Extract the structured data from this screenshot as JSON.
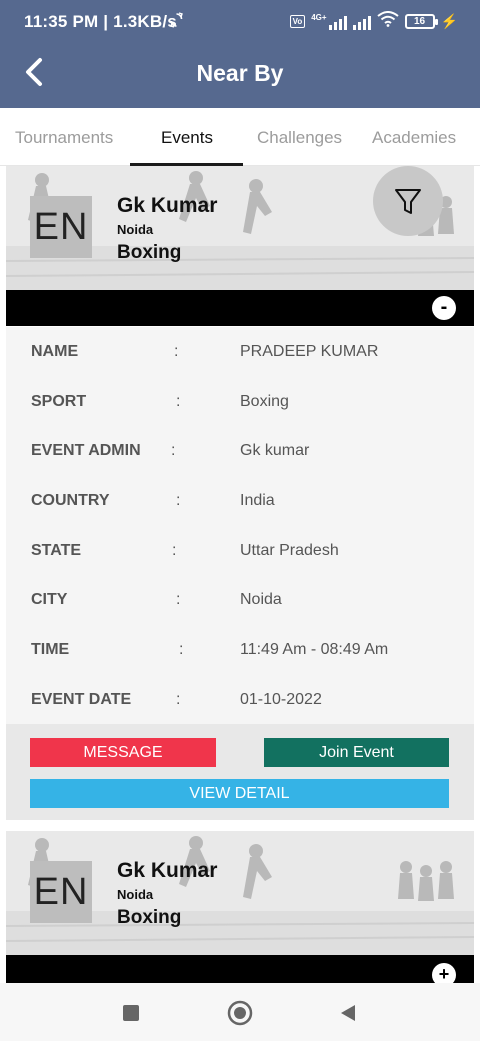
{
  "status_bar": {
    "time_speed": "11:35 PM | 1.3KB/s",
    "sync_icon": "sync-icon",
    "network_badge": "4G+",
    "battery_level": "16",
    "charging_icon": "bolt-icon"
  },
  "header": {
    "title": "Near By",
    "back_icon": "back-arrow-icon"
  },
  "tabs": [
    {
      "label": "Tournaments",
      "active": false
    },
    {
      "label": "Events",
      "active": true
    },
    {
      "label": "Challenges",
      "active": false
    },
    {
      "label": "Academies",
      "active": false
    }
  ],
  "filter_icon": "filter-funnel-icon",
  "events": [
    {
      "avatar_text": "EN",
      "name": "Gk Kumar",
      "city": "Noida",
      "sport": "Boxing",
      "toggle": "-",
      "details": [
        {
          "label": "NAME",
          "value": "PRADEEP KUMAR"
        },
        {
          "label": "SPORT",
          "value": "Boxing"
        },
        {
          "label": "EVENT ADMIN",
          "value": "Gk kumar"
        },
        {
          "label": "COUNTRY",
          "value": "India"
        },
        {
          "label": "STATE",
          "value": "Uttar Pradesh"
        },
        {
          "label": "CITY",
          "value": "Noida"
        },
        {
          "label": "TIME",
          "value": "11:49 Am - 08:49 Am"
        },
        {
          "label": "EVENT DATE",
          "value": "01-10-2022"
        }
      ],
      "separator": ":",
      "buttons": {
        "message": "MESSAGE",
        "join": "Join Event",
        "view": "VIEW DETAIL"
      },
      "colors": {
        "message": "#f0354b",
        "join": "#127160",
        "view": "#35b3e6"
      }
    },
    {
      "avatar_text": "EN",
      "name": "Gk Kumar",
      "city": "Noida",
      "sport": "Boxing",
      "toggle": "+"
    }
  ],
  "nav": [
    "recent-apps-icon",
    "home-icon",
    "back-triangle-icon"
  ],
  "colors": {
    "header_bg": "#56698f"
  }
}
